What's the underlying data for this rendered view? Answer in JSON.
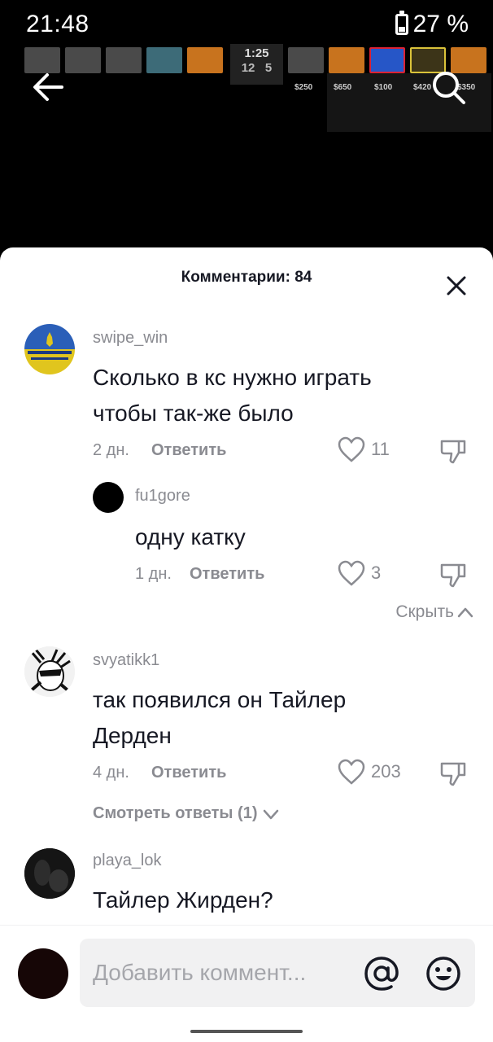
{
  "status_bar": {
    "time": "21:48",
    "battery": "27 %"
  },
  "video": {
    "hud_time": "1:25",
    "hud_score_ct": "12",
    "hud_score_t": "5",
    "hud_money": [
      "$250",
      "$650",
      "$100",
      "$420",
      "$350"
    ]
  },
  "sheet": {
    "title": "Комментарии: 84",
    "hide_label": "Скрыть",
    "comments": [
      {
        "username": "swipe_win",
        "text": "Сколько в кс нужно играть чтобы так-же было",
        "time": "2 дн.",
        "reply_label": "Ответить",
        "likes": "11",
        "replies": [
          {
            "username": "fu1gore",
            "text": "одну катку",
            "time": "1 дн.",
            "reply_label": "Ответить",
            "likes": "3"
          }
        ]
      },
      {
        "username": "svyatikk1",
        "text": "так появился он Тайлер Дерден",
        "time": "4 дн.",
        "reply_label": "Ответить",
        "likes": "203",
        "view_replies": "Смотреть ответы (1)"
      },
      {
        "username": "playa_lok",
        "text": "Тайлер Жирден?"
      }
    ]
  },
  "input": {
    "placeholder": "Добавить коммент..."
  },
  "colors": {
    "secondary_text": "#8a8b91",
    "primary_text": "#161823",
    "input_bg": "#f1f1f2"
  },
  "icons": [
    "back-arrow-icon",
    "search-icon",
    "close-icon",
    "heart-icon",
    "dislike-icon",
    "chevron-up-icon",
    "chevron-down-icon",
    "at-icon",
    "emoji-icon",
    "battery-icon"
  ]
}
